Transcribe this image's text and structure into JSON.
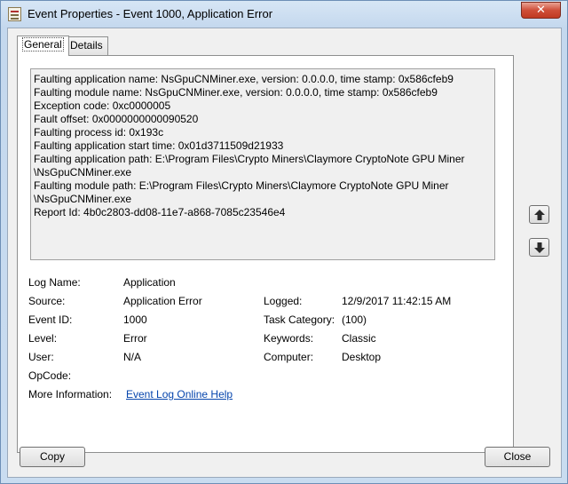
{
  "window": {
    "title": "Event Properties - Event 1000, Application Error",
    "close_glyph": "✕"
  },
  "tabs": [
    {
      "label": "General",
      "active": true
    },
    {
      "label": "Details",
      "active": false
    }
  ],
  "description_lines": [
    "Faulting application name: NsGpuCNMiner.exe, version: 0.0.0.0, time stamp: 0x586cfeb9",
    "Faulting module name: NsGpuCNMiner.exe, version: 0.0.0.0, time stamp: 0x586cfeb9",
    "Exception code: 0xc0000005",
    "Fault offset: 0x0000000000090520",
    "Faulting process id: 0x193c",
    "Faulting application start time: 0x01d3711509d21933",
    "Faulting application path: E:\\Program Files\\Crypto Miners\\Claymore CryptoNote GPU Miner",
    "\\NsGpuCNMiner.exe",
    "Faulting module path: E:\\Program Files\\Crypto Miners\\Claymore CryptoNote GPU Miner",
    "\\NsGpuCNMiner.exe",
    "Report Id: 4b0c2803-dd08-11e7-a868-7085c23546e4"
  ],
  "fields": {
    "log_name": {
      "label": "Log Name:",
      "value": "Application"
    },
    "source": {
      "label": "Source:",
      "value": "Application Error"
    },
    "logged": {
      "label": "Logged:",
      "value": "12/9/2017 11:42:15 AM"
    },
    "event_id": {
      "label": "Event ID:",
      "value": "1000"
    },
    "task_category": {
      "label": "Task Category:",
      "value": "(100)"
    },
    "level": {
      "label": "Level:",
      "value": "Error"
    },
    "keywords": {
      "label": "Keywords:",
      "value": "Classic"
    },
    "user": {
      "label": "User:",
      "value": "N/A"
    },
    "computer": {
      "label": "Computer:",
      "value": "Desktop"
    },
    "opcode": {
      "label": "OpCode:",
      "value": ""
    },
    "more_info": {
      "label": "More Information:",
      "link": "Event Log Online Help"
    }
  },
  "buttons": {
    "copy": "Copy",
    "close": "Close"
  },
  "icons": {
    "up": "arrow-up-icon",
    "down": "arrow-down-icon"
  }
}
